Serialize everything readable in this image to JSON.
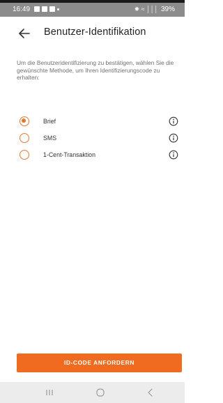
{
  "status_bar": {
    "time": "16:49",
    "battery": "39%",
    "connectivity": "✹ ≈ │││"
  },
  "header": {
    "title": "Benutzer-Identifikation",
    "back_icon": "arrow-left-icon"
  },
  "description": "Um die Benutzeridentifizierung zu bestätigen, wählen Sie die gewünschte Methode, um Ihren Identifizierungscode zu erhalten:",
  "options": [
    {
      "label": "Brief",
      "selected": true,
      "info_icon": "info-icon"
    },
    {
      "label": "SMS",
      "selected": false,
      "info_icon": "info-icon"
    },
    {
      "label": "1-Cent-Transaktion",
      "selected": false,
      "info_icon": "info-icon"
    }
  ],
  "cta": {
    "label": "ID-CODE ANFORDERN"
  },
  "nav": {
    "icons": [
      "recent-apps-icon",
      "home-icon",
      "back-icon"
    ]
  },
  "colors": {
    "accent": "#e3782f",
    "button": "#f06b1f",
    "status_bar": "#8c8c8c",
    "nav_bar": "#ececec"
  }
}
